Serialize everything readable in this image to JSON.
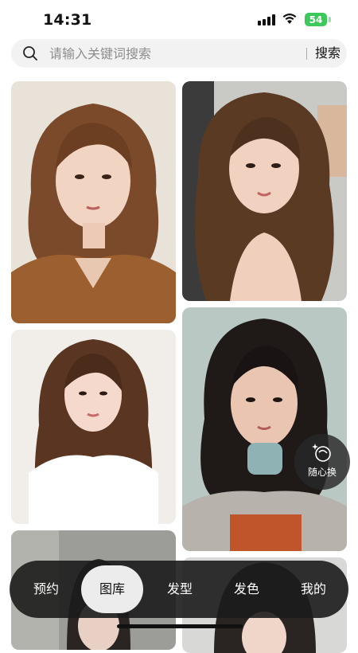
{
  "status_bar": {
    "time": "14:31",
    "battery": "54"
  },
  "search": {
    "placeholder": "请输入关键词搜索",
    "button_label": "搜索"
  },
  "float_button": {
    "label": "随心换"
  },
  "nav": {
    "items": [
      {
        "label": "预约"
      },
      {
        "label": "图库"
      },
      {
        "label": "发型"
      },
      {
        "label": "发色"
      },
      {
        "label": "我的"
      }
    ],
    "active": "图库"
  }
}
